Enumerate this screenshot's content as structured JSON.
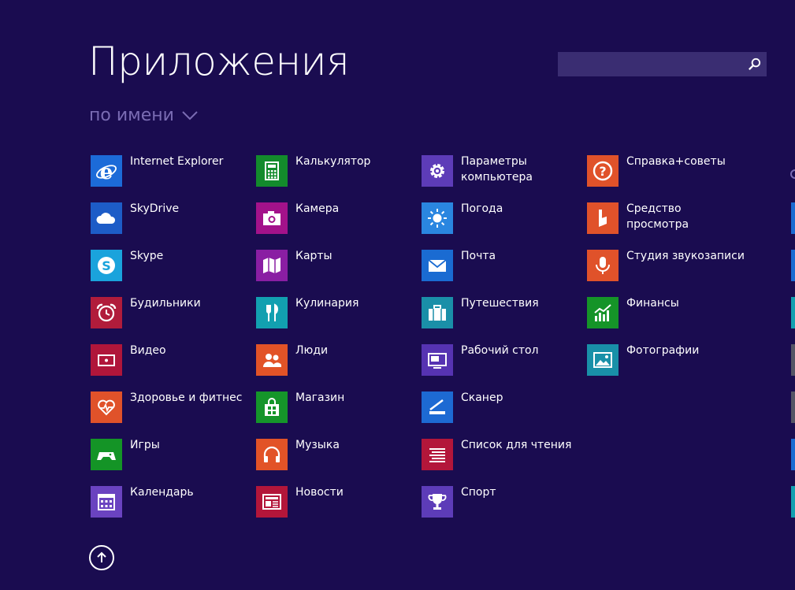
{
  "header": {
    "title": "Приложения",
    "sort_label": "по имени"
  },
  "search": {
    "value": "",
    "placeholder": ""
  },
  "columns": [
    [
      {
        "label": "Internet Explorer",
        "icon": "internet-explorer-icon",
        "color": "#1c6bd8"
      },
      {
        "label": "SkyDrive",
        "icon": "cloud-icon",
        "color": "#1d5cc7"
      },
      {
        "label": "Skype",
        "icon": "skype-icon",
        "color": "#1aa3dc"
      },
      {
        "label": "Будильники",
        "icon": "alarm-clock-icon",
        "color": "#b11c3b"
      },
      {
        "label": "Видео",
        "icon": "video-icon",
        "color": "#b0163a"
      },
      {
        "label": "Здоровье и фитнес",
        "icon": "heart-pulse-icon",
        "color": "#e0522a"
      },
      {
        "label": "Игры",
        "icon": "gamepad-icon",
        "color": "#149426"
      },
      {
        "label": "Календарь",
        "icon": "calendar-icon",
        "color": "#6a43c0"
      }
    ],
    [
      {
        "label": "Калькулятор",
        "icon": "calculator-icon",
        "color": "#138b2c"
      },
      {
        "label": "Камера",
        "icon": "camera-icon",
        "color": "#a3128a"
      },
      {
        "label": "Карты",
        "icon": "map-icon",
        "color": "#8a1ea3"
      },
      {
        "label": "Кулинария",
        "icon": "fork-knife-icon",
        "color": "#12a0b0"
      },
      {
        "label": "Люди",
        "icon": "people-icon",
        "color": "#e25327"
      },
      {
        "label": "Магазин",
        "icon": "store-icon",
        "color": "#15952a"
      },
      {
        "label": "Музыка",
        "icon": "headphones-icon",
        "color": "#e25327"
      },
      {
        "label": "Новости",
        "icon": "newspaper-icon",
        "color": "#b3163a"
      }
    ],
    [
      {
        "label": "Параметры компьютера",
        "icon": "gear-icon",
        "color": "#5d3cb8"
      },
      {
        "label": "Погода",
        "icon": "sun-icon",
        "color": "#2a86e0"
      },
      {
        "label": "Почта",
        "icon": "mail-icon",
        "color": "#1a6bd2"
      },
      {
        "label": "Путешествия",
        "icon": "suitcase-icon",
        "color": "#1a8fa8"
      },
      {
        "label": "Рабочий стол",
        "icon": "desktop-icon",
        "color": "#5633b2"
      },
      {
        "label": "Сканер",
        "icon": "scanner-icon",
        "color": "#1d6ad3"
      },
      {
        "label": "Список для чтения",
        "icon": "reading-list-icon",
        "color": "#b3163a"
      },
      {
        "label": "Спорт",
        "icon": "trophy-icon",
        "color": "#5d3cb8"
      }
    ],
    [
      {
        "label": "Справка+советы",
        "icon": "question-icon",
        "color": "#e0522a"
      },
      {
        "label": "Средство просмотра",
        "icon": "reader-icon",
        "color": "#e0522a"
      },
      {
        "label": "Студия звукозаписи",
        "icon": "microphone-icon",
        "color": "#e0522a"
      },
      {
        "label": "Финансы",
        "icon": "finance-chart-icon",
        "color": "#159428"
      },
      {
        "label": "Фотографии",
        "icon": "photo-icon",
        "color": "#1990a8"
      }
    ]
  ],
  "edge_colors": [
    "#1a6bd2",
    "#1a6bd2",
    "#12a0b0",
    "#555566",
    "#555566",
    "#1a6bd2",
    "#12a0b0"
  ]
}
